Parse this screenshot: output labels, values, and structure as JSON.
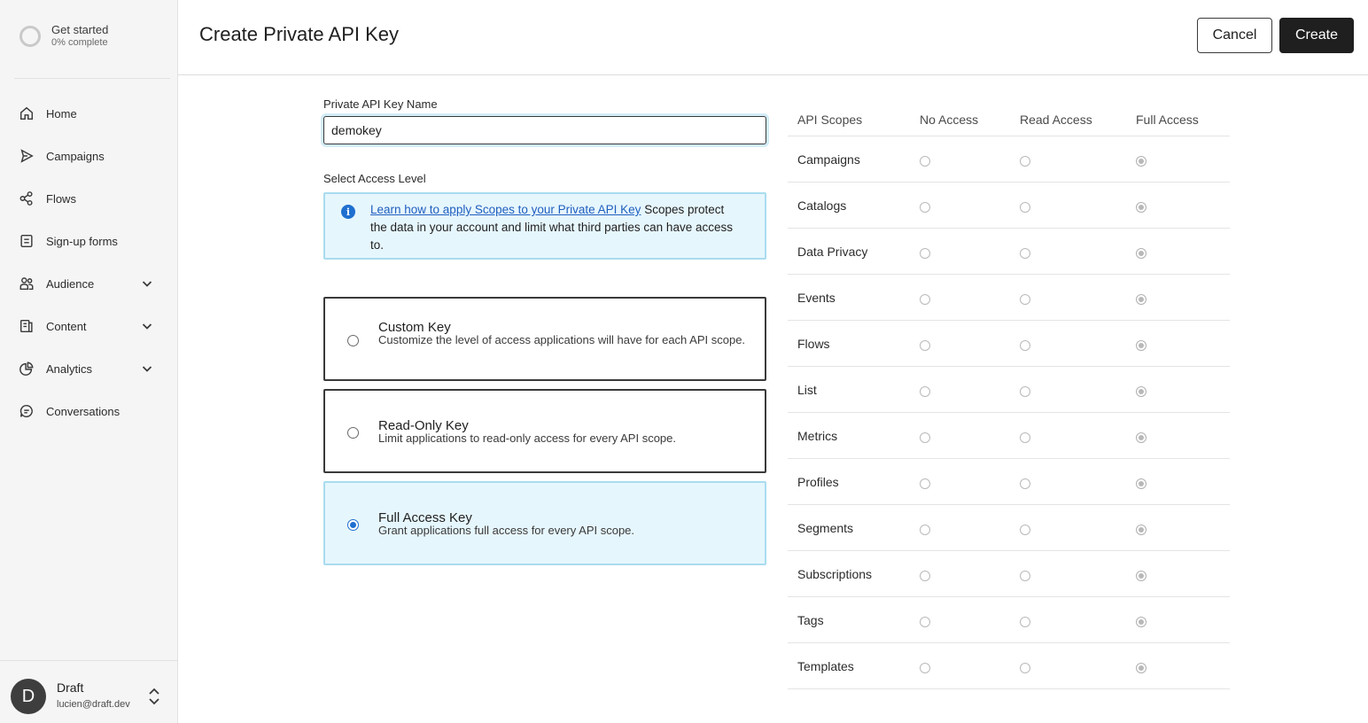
{
  "sidebar": {
    "get_started": {
      "title": "Get started",
      "progress": "0% complete",
      "progress_value": 0
    },
    "items": [
      {
        "label": "Home",
        "icon": "home-icon",
        "expandable": false
      },
      {
        "label": "Campaigns",
        "icon": "send-icon",
        "expandable": false
      },
      {
        "label": "Flows",
        "icon": "flows-icon",
        "expandable": false
      },
      {
        "label": "Sign-up forms",
        "icon": "form-icon",
        "expandable": false
      },
      {
        "label": "Audience",
        "icon": "people-icon",
        "expandable": true
      },
      {
        "label": "Content",
        "icon": "content-icon",
        "expandable": true
      },
      {
        "label": "Analytics",
        "icon": "pie-chart-icon",
        "expandable": true
      },
      {
        "label": "Conversations",
        "icon": "chat-icon",
        "expandable": false
      }
    ],
    "user": {
      "initial": "D",
      "name": "Draft",
      "email": "lucien@draft.dev"
    }
  },
  "header": {
    "title": "Create Private API Key",
    "cancel_label": "Cancel",
    "create_label": "Create"
  },
  "form": {
    "name_label": "Private API Key Name",
    "name_value": "demokey",
    "access_label": "Select Access Level",
    "info": {
      "link_text": "Learn how to apply Scopes to your Private API Key",
      "text": " Scopes protect the data in your account and limit what third parties can have access to."
    },
    "options": [
      {
        "title": "Custom Key",
        "description": "Customize the level of access applications will have for each API scope.",
        "selected": false
      },
      {
        "title": "Read-Only Key",
        "description": "Limit applications to read-only access for every API scope.",
        "selected": false
      },
      {
        "title": "Full Access Key",
        "description": "Grant applications full access for every API scope.",
        "selected": true
      }
    ]
  },
  "scopes": {
    "headers": [
      "API Scopes",
      "No Access",
      "Read Access",
      "Full Access"
    ],
    "rows": [
      {
        "name": "Campaigns",
        "access": "Full Access"
      },
      {
        "name": "Catalogs",
        "access": "Full Access"
      },
      {
        "name": "Data Privacy",
        "access": "Full Access"
      },
      {
        "name": "Events",
        "access": "Full Access"
      },
      {
        "name": "Flows",
        "access": "Full Access"
      },
      {
        "name": "List",
        "access": "Full Access"
      },
      {
        "name": "Metrics",
        "access": "Full Access"
      },
      {
        "name": "Profiles",
        "access": "Full Access"
      },
      {
        "name": "Segments",
        "access": "Full Access"
      },
      {
        "name": "Subscriptions",
        "access": "Full Access"
      },
      {
        "name": "Tags",
        "access": "Full Access"
      },
      {
        "name": "Templates",
        "access": "Full Access"
      }
    ]
  },
  "colors": {
    "accent": "#1f6fd0",
    "selected_bg": "#e6f6fd",
    "selected_border": "#a9dcef",
    "primary_button": "#1f1f1f"
  }
}
